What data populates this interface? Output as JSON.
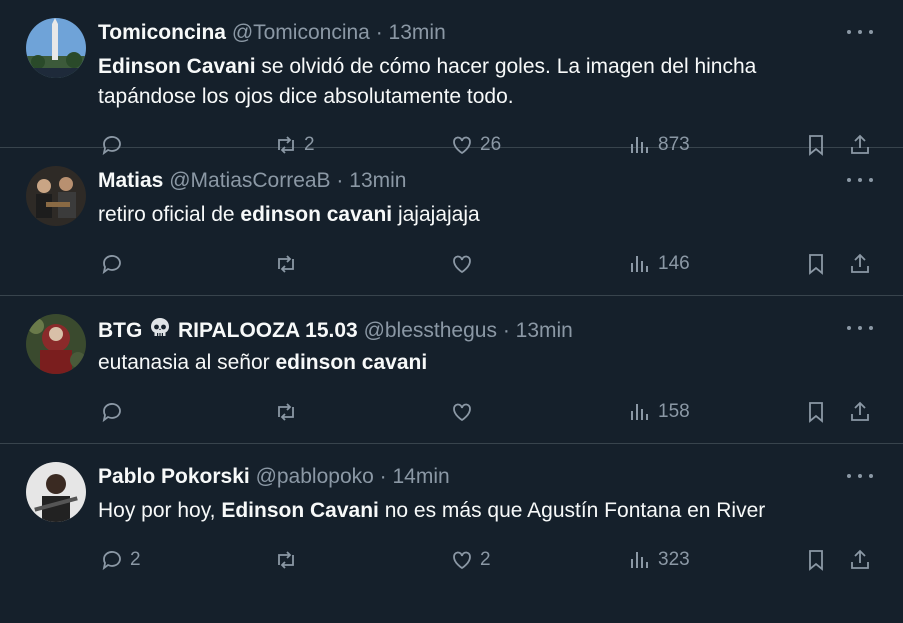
{
  "tweets": [
    {
      "name": "Tomiconcina",
      "handle": "@Tomiconcina",
      "separator": "·",
      "time": "13min",
      "text_bold": "Edinson Cavani",
      "text_pre": "",
      "text_post": " se olvidó de cómo hacer goles. La imagen del hincha tapándose los ojos dice absolutamente todo.",
      "replies": "",
      "retweets": "2",
      "likes": "26",
      "views": "873"
    },
    {
      "name": "Matias",
      "handle": "@MatiasCorreaB",
      "separator": "·",
      "time": "13min",
      "text_pre": "retiro oficial de ",
      "text_bold": "edinson cavani",
      "text_post": " jajajajaja",
      "replies": "",
      "retweets": "",
      "likes": "",
      "views": "146"
    },
    {
      "name_pre": "BTG ",
      "name_post": " RIPALOOZA 15.03",
      "name_emoji": "skull-emoji",
      "handle": "@blessthegus",
      "separator": "·",
      "time": "13min",
      "text_pre": "eutanasia al señor ",
      "text_bold": "edinson cavani",
      "text_post": "",
      "replies": "",
      "retweets": "",
      "likes": "",
      "views": "158"
    },
    {
      "name": "Pablo Pokorski",
      "handle": "@pablopoko",
      "separator": "·",
      "time": "14min",
      "text_pre": "Hoy por hoy, ",
      "text_bold": "Edinson Cavani",
      "text_post": " no es más que Agustín Fontana en River",
      "replies": "2",
      "retweets": "",
      "likes": "2",
      "views": "323"
    }
  ],
  "icons": {
    "reply": "reply-icon",
    "retweet": "retweet-icon",
    "like": "heart-icon",
    "views": "views-chart-icon",
    "bookmark": "bookmark-icon",
    "share": "share-icon",
    "more": "more-options-icon"
  },
  "colors": {
    "background": "#15202b",
    "text": "#f7f9f9",
    "muted": "#8b98a5",
    "divider": "#38444d"
  }
}
